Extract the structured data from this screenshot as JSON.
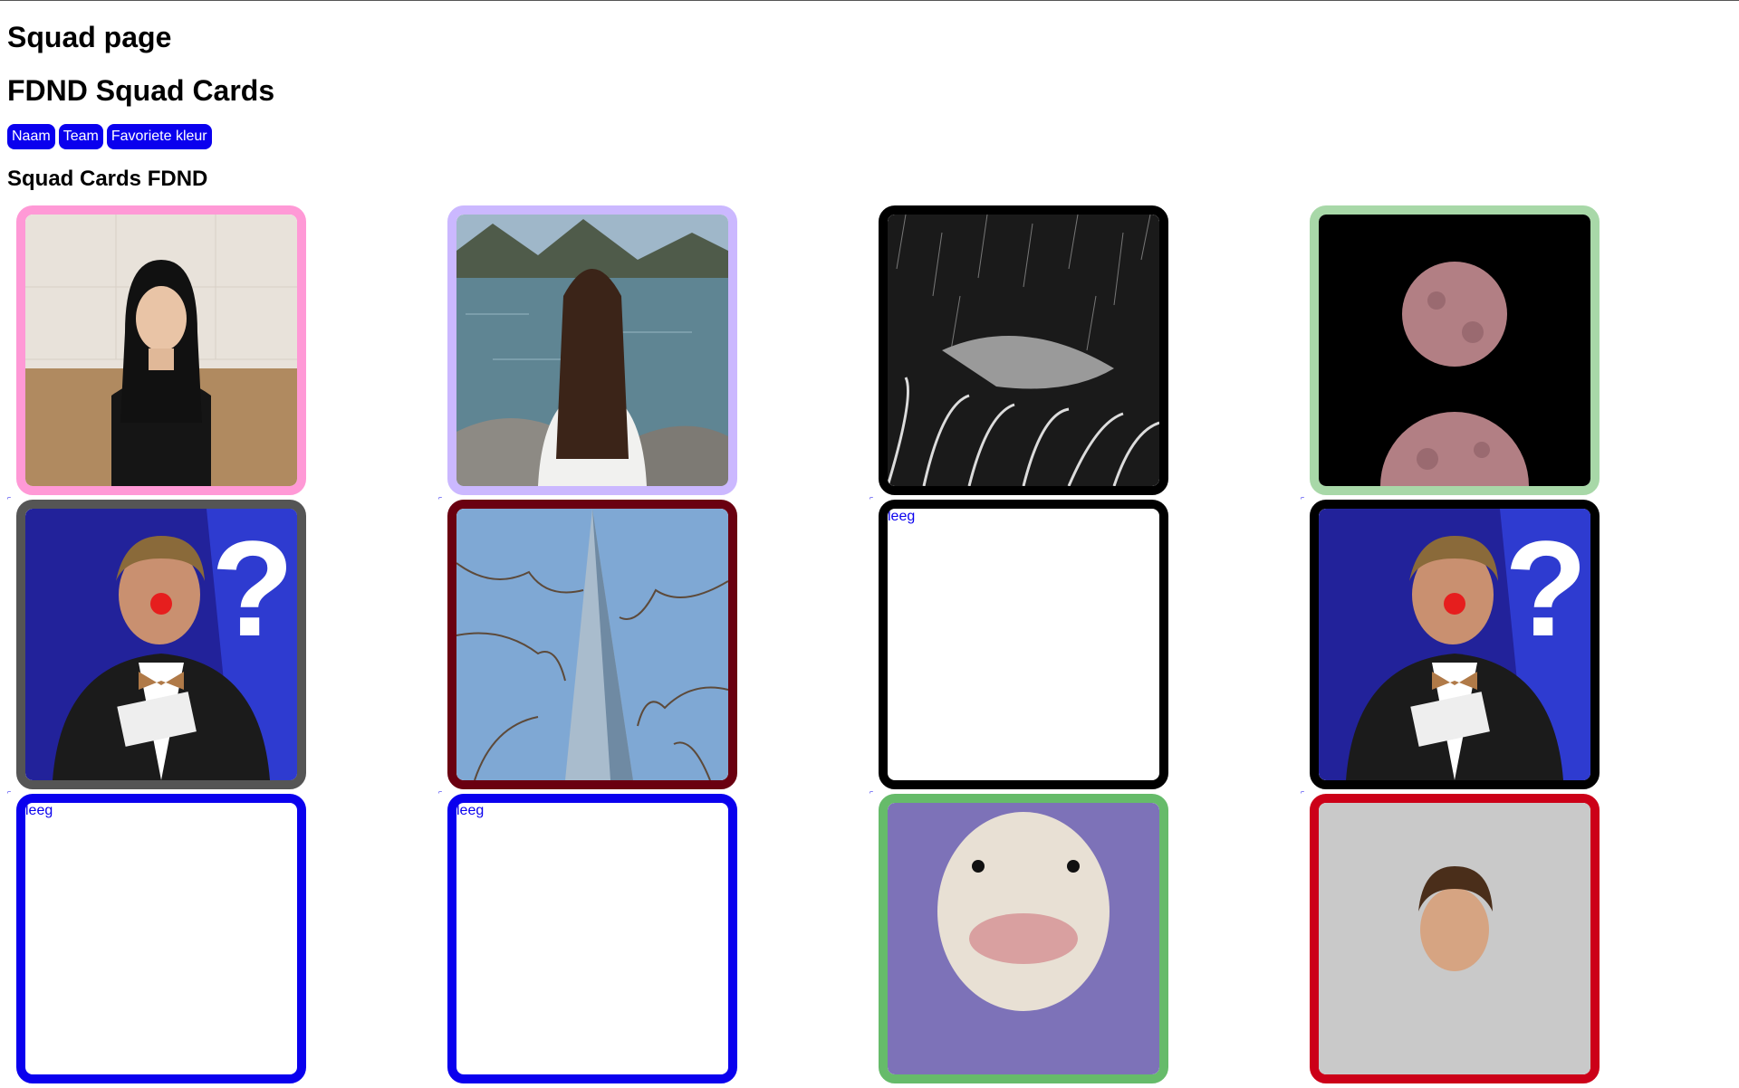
{
  "page": {
    "title": "Squad page",
    "subtitle": "FDND Squad Cards",
    "section_title": "Squad Cards FDND"
  },
  "filters": [
    {
      "label": "Naam"
    },
    {
      "label": "Team"
    },
    {
      "label": "Favoriete kleur"
    }
  ],
  "cards": [
    {
      "border": "#ff99d6",
      "kind": "portrait-woman",
      "label": ""
    },
    {
      "border": "#cbb8ff",
      "kind": "lake-girl",
      "label": ""
    },
    {
      "border": "#000000",
      "kind": "manga-rain",
      "label": ""
    },
    {
      "border": "#a8d8a8",
      "kind": "moons",
      "label": ""
    },
    {
      "border": "#555555",
      "kind": "clown-host",
      "label": ""
    },
    {
      "border": "#6a0010",
      "kind": "skyscraper",
      "label": ""
    },
    {
      "border": "#000000",
      "kind": "empty",
      "label": "leeg"
    },
    {
      "border": "#000000",
      "kind": "clown-host",
      "label": ""
    },
    {
      "border": "#0a00ee",
      "kind": "empty",
      "label": "leeg"
    },
    {
      "border": "#0a00ee",
      "kind": "empty",
      "label": "leeg"
    },
    {
      "border": "#66bb6a",
      "kind": "duck",
      "label": ""
    },
    {
      "border": "#cc0018",
      "kind": "boy",
      "label": ""
    }
  ],
  "link_marker": "⌐"
}
